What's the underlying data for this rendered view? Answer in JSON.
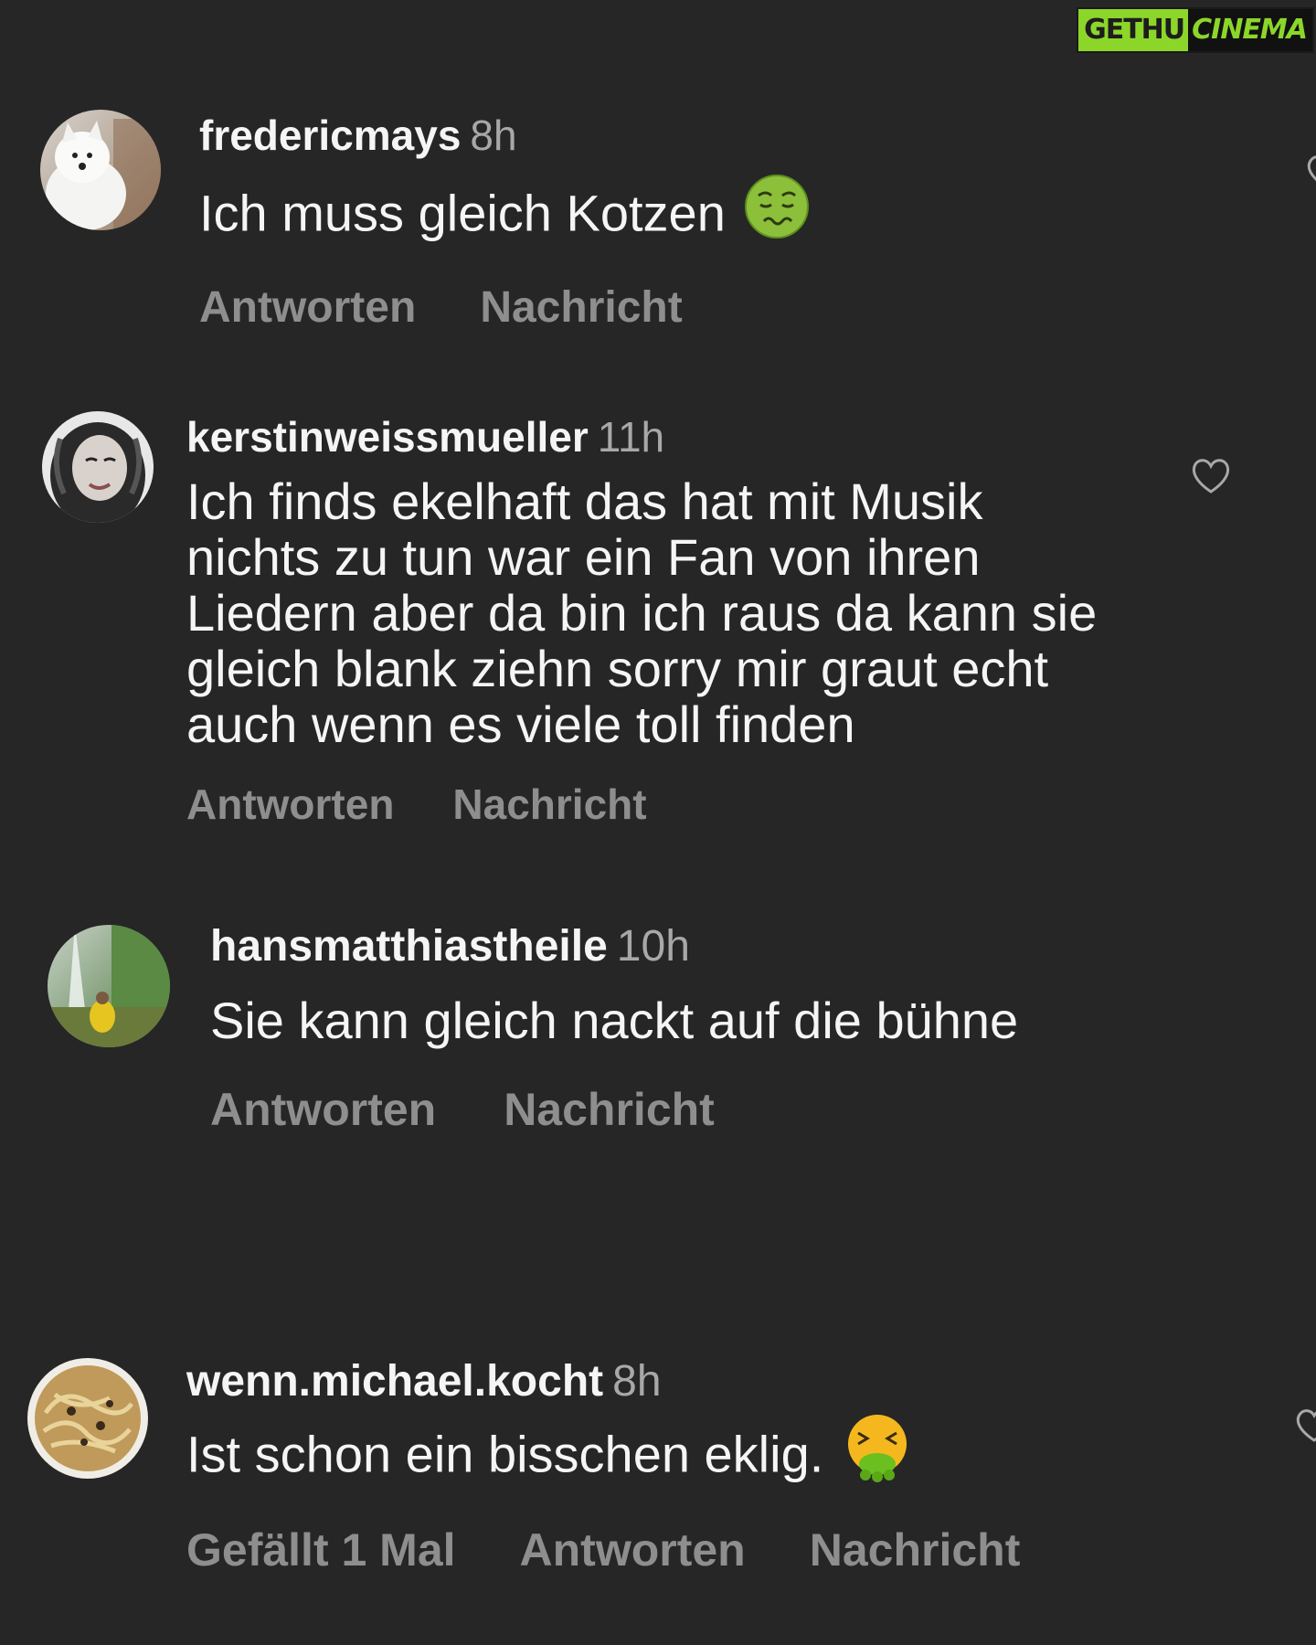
{
  "watermark": {
    "left": "GETHU",
    "right": "CINEMA"
  },
  "comments": [
    {
      "username": "fredericmays",
      "time": "8h",
      "text": "Ich muss gleich Kotzen",
      "emoji_icon": "nauseated-face-icon",
      "actions": [
        "Antworten",
        "Nachricht"
      ]
    },
    {
      "username": "kerstinweissmueller",
      "time": "11h",
      "text": "Ich finds ekelhaft das hat mit Musik nichts zu tun war ein Fan von ihren Liedern aber da bin ich raus da kann sie gleich blank ziehn sorry mir graut echt auch wenn es viele toll finden",
      "actions": [
        "Antworten",
        "Nachricht"
      ]
    },
    {
      "username": "hansmatthiastheile",
      "time": "10h",
      "text": "Sie kann gleich nackt auf die bühne",
      "actions": [
        "Antworten",
        "Nachricht"
      ]
    },
    {
      "username": "wenn.michael.kocht",
      "time": "8h",
      "text": "Ist schon ein bisschen eklig.",
      "emoji_icon": "vomiting-face-icon",
      "likes": "Gefällt 1 Mal",
      "actions": [
        "Antworten",
        "Nachricht"
      ]
    }
  ],
  "colors": {
    "background": "#262626",
    "primary_text": "#f5f5f5",
    "secondary_text": "#a8a8a8",
    "action_text": "#8e8e8e",
    "watermark_green": "#8cd62a"
  }
}
